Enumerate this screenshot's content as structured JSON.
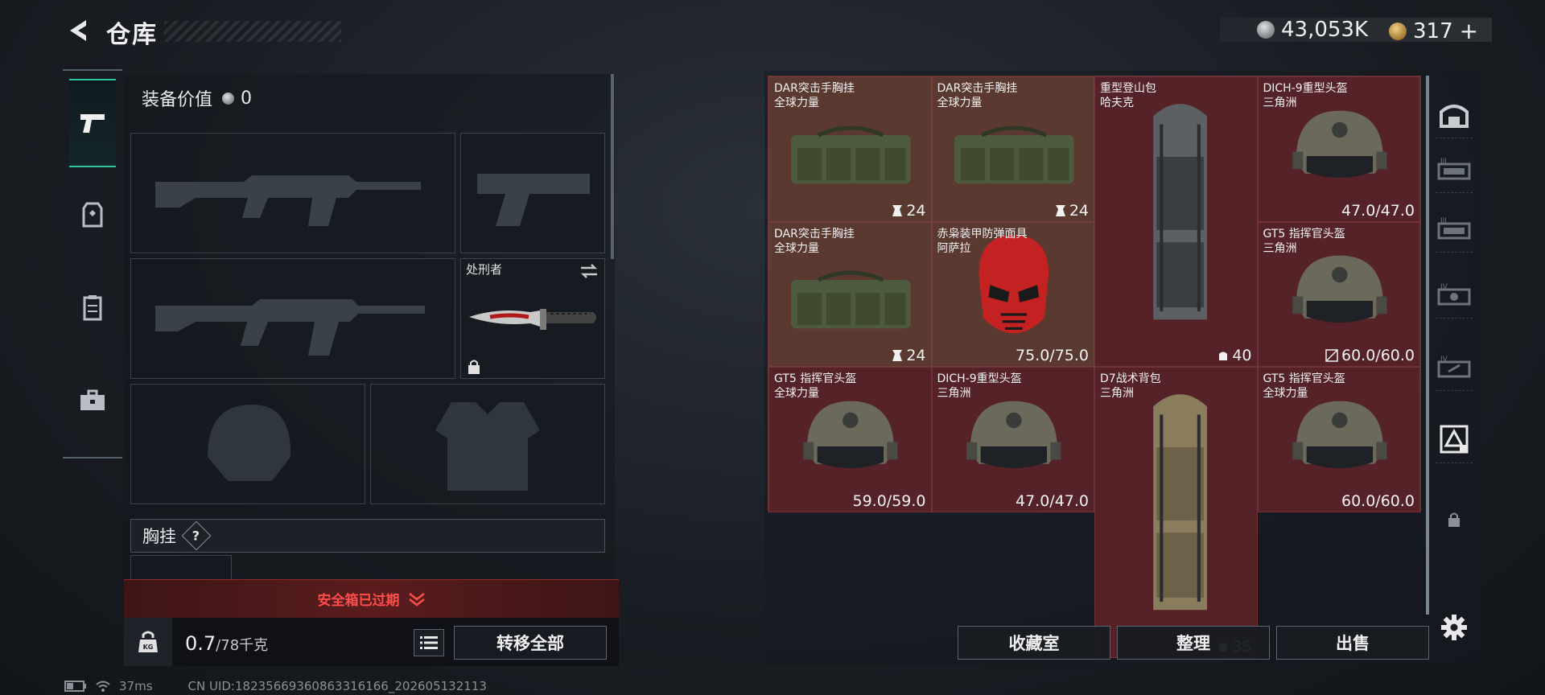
{
  "header": {
    "title": "仓库",
    "silver_amount": "43,053K",
    "gold_amount": "317",
    "gold_plus": "+"
  },
  "loadout": {
    "equip_value_label": "装备价值",
    "equip_value": "0",
    "melee_name": "处刑者",
    "chest_label": "胸挂",
    "chest_help": "?",
    "safebox_expired": "安全箱已过期",
    "weight_current": "0.7",
    "weight_max": "/78千克",
    "weight_icon_text": "KG",
    "transfer_all": "转移全部"
  },
  "storage": {
    "items": [
      {
        "name": "DAR突击手胸挂",
        "sub": "全球力量",
        "value": "24",
        "kind": "rig"
      },
      {
        "name": "DAR突击手胸挂",
        "sub": "全球力量",
        "value": "24",
        "kind": "rig"
      },
      {
        "name": "重型登山包",
        "sub": "哈夫克",
        "value": "40",
        "kind": "backpack"
      },
      {
        "name": "DICH-9重型头盔",
        "sub": "三角洲",
        "value": "47.0/47.0",
        "kind": "helmet"
      },
      {
        "name": "DAR突击手胸挂",
        "sub": "全球力量",
        "value": "24",
        "kind": "rig"
      },
      {
        "name": "赤枭装甲防弹面具",
        "sub": "阿萨拉",
        "value": "75.0/75.0",
        "kind": "mask"
      },
      {
        "name": "GT5 指挥官头盔",
        "sub": "三角洲",
        "value": "60.0/60.0",
        "kind": "helmet"
      },
      {
        "name": "D7战术背包",
        "sub": "三角洲",
        "value": "35",
        "kind": "backpack"
      },
      {
        "name": "GT5 指挥官头盔",
        "sub": "全球力量",
        "value": "59.0/59.0",
        "kind": "helmet"
      },
      {
        "name": "DICH-9重型头盔",
        "sub": "三角洲",
        "value": "47.0/47.0",
        "kind": "helmet"
      },
      {
        "name": "GT5 指挥官头盔",
        "sub": "全球力量",
        "value": "60.0/60.0",
        "kind": "helmet"
      }
    ],
    "btn_collection": "收藏室",
    "btn_organize": "整理",
    "btn_sell": "出售"
  },
  "status": {
    "ping": "37ms",
    "uid": "CN UID:18235669360863316166_202605132113"
  },
  "colors": {
    "accent": "#2ec4a0",
    "alert": "#ff4d4d",
    "grid_bg": "#552227"
  }
}
